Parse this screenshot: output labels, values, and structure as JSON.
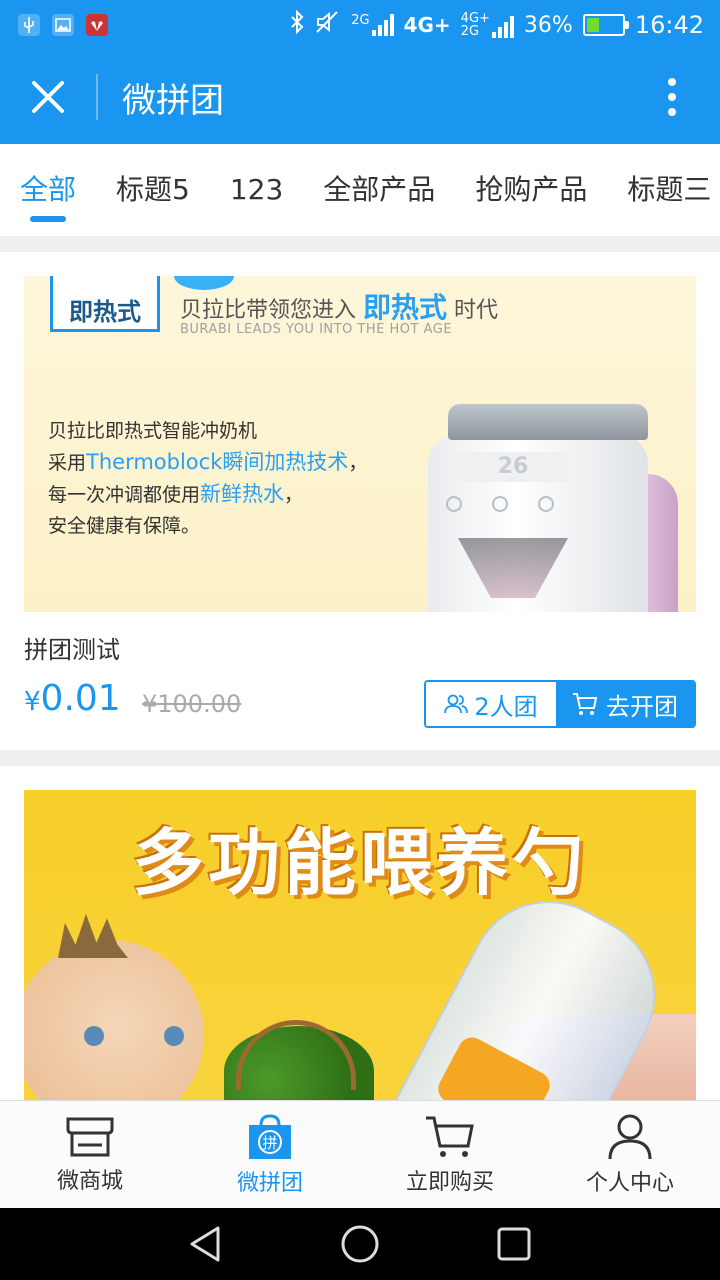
{
  "status_bar": {
    "network_small_top": "2G",
    "network_4g_a": "4G+",
    "network_4g_b_top": "4G+",
    "network_4g_b_bottom": "2G",
    "battery_percent_text": "36%",
    "battery_level": 0.36,
    "time": "16:42"
  },
  "titlebar": {
    "title": "微拼团"
  },
  "tabs": [
    {
      "label": "全部",
      "active": true
    },
    {
      "label": "标题5"
    },
    {
      "label": "123"
    },
    {
      "label": "全部产品"
    },
    {
      "label": "抢购产品"
    },
    {
      "label": "标题三"
    }
  ],
  "products": [
    {
      "banner": {
        "badge": "即热式",
        "headline_pre": "贝拉比带领您进入",
        "headline_hl": "即热式",
        "headline_post": "时代",
        "subline": "BURABI LEADS YOU INTO THE HOT AGE",
        "line1": "贝拉比即热式智能冲奶机",
        "line2_pre": "采用",
        "line2_hl": "Thermoblock瞬间加热技术",
        "line2_post": "，",
        "line3_pre": "每一次冲调都使用",
        "line3_hl": "新鲜热水",
        "line3_post": "，",
        "line4": "安全健康有保障。",
        "screen_text": "26"
      },
      "title": "拼团测试",
      "currency": "¥",
      "price": "0.01",
      "original_price": "¥100.00",
      "group_size": "2人团",
      "open_group": "去开团"
    },
    {
      "banner": {
        "headline": "多功能喂养勺"
      }
    }
  ],
  "bottom_nav": [
    {
      "label": "微商城",
      "icon": "store-icon"
    },
    {
      "label": "微拼团",
      "icon": "group-buy-bag-icon",
      "active": true,
      "icon_char": "拼"
    },
    {
      "label": "立即购买",
      "icon": "cart-icon"
    },
    {
      "label": "个人中心",
      "icon": "user-icon"
    }
  ],
  "colors": {
    "accent": "#1a96f0",
    "text": "#333333",
    "muted": "#aaaaaa"
  }
}
